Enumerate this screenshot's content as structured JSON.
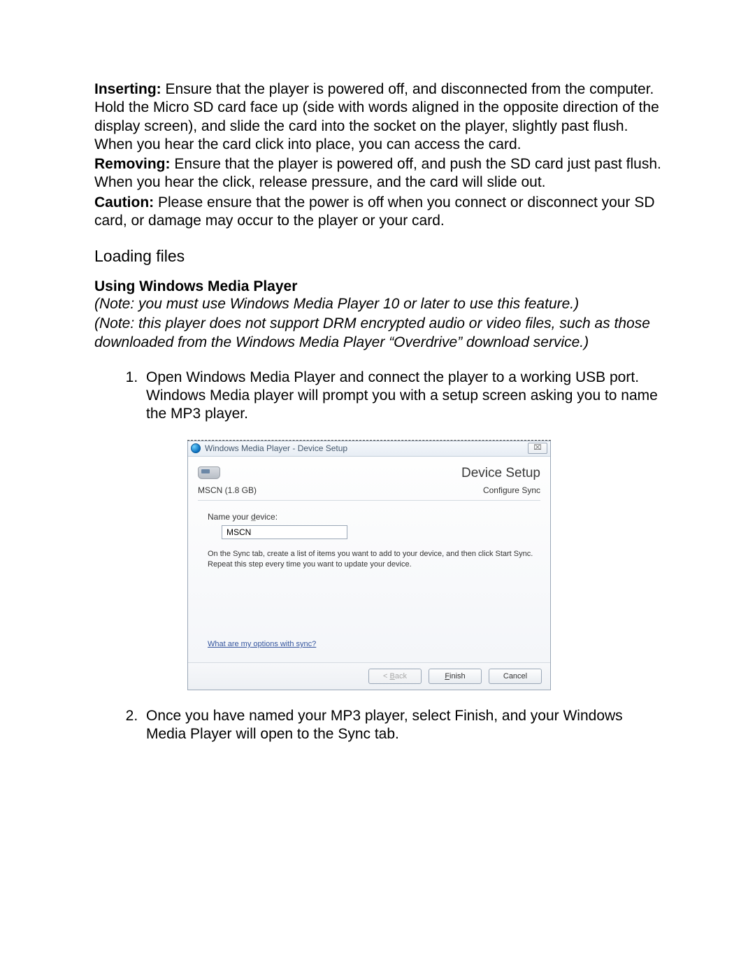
{
  "doc": {
    "inserting_label": "Inserting:",
    "inserting_text": " Ensure that the player is powered off, and disconnected from the computer. Hold the Micro SD card face up (side with words aligned in the opposite direction of the display screen), and slide the card into the socket on the player, slightly past flush. When you hear the card click into place, you can access the card.",
    "removing_label": "Removing:",
    "removing_text": " Ensure that the player is powered off, and push the SD card just past flush. When you hear the click, release pressure, and the card will slide out.",
    "caution_label": "Caution:",
    "caution_text": " Please ensure that the power is off when you connect or disconnect your SD card, or damage may occur to the player or your card.",
    "section_heading": "Loading files",
    "subheading": "Using Windows Media Player",
    "note1": "(Note: you must use Windows Media Player 10 or later to use this feature.)",
    "note2": "(Note: this player does not support DRM encrypted audio or video files, such as those downloaded from the Windows Media Player “Overdrive” download service.)",
    "step1": "Open Windows Media Player and connect the player to a working USB port. Windows Media player will prompt you with a setup screen asking you to name the MP3 player.",
    "step2": "Once you have named your MP3 player, select Finish, and your Windows Media Player will open to the Sync tab."
  },
  "dialog": {
    "title": "Windows Media Player - Device Setup",
    "close_glyph": "⌧",
    "big_heading": "Device Setup",
    "device_name_size": "MSCN (1.8 GB)",
    "configure_sync": "Configure Sync",
    "name_label_pre": "Name your ",
    "name_label_underlined": "d",
    "name_label_post": "evice:",
    "name_value": "MSCN",
    "instructions": "On the Sync tab, create a list of items you want to add to your device, and then click Start Sync. Repeat this step every time you want to update your device.",
    "help_link": "What are my options with sync?",
    "back_pre": "< ",
    "back_u": "B",
    "back_post": "ack",
    "finish_u": "F",
    "finish_post": "inish",
    "cancel": "Cancel"
  }
}
